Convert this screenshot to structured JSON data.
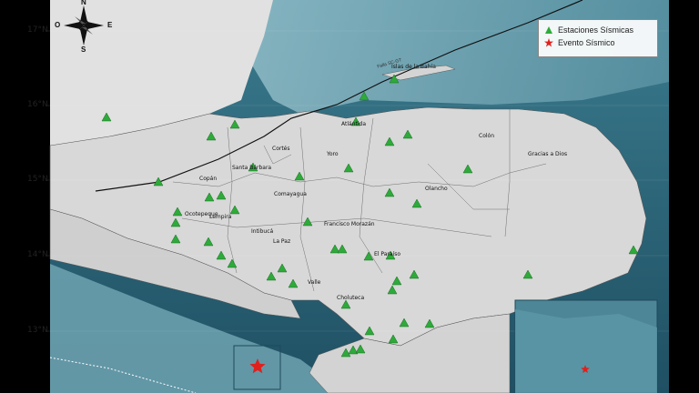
{
  "map": {
    "latitude_labels": [
      "17°N",
      "16°N",
      "15°N",
      "14°N",
      "13°N"
    ],
    "compass": {
      "north": "N",
      "south": "S",
      "east": "E",
      "west": "O"
    },
    "fault_label": "Falla SC-GT",
    "places": [
      {
        "name": "Islas de la Bahía"
      },
      {
        "name": "Atlántida"
      },
      {
        "name": "Colón"
      },
      {
        "name": "Cortés"
      },
      {
        "name": "Yoro"
      },
      {
        "name": "Santa Bárbara"
      },
      {
        "name": "Copán"
      },
      {
        "name": "Gracias a Dios"
      },
      {
        "name": "Comayagua"
      },
      {
        "name": "Olancho"
      },
      {
        "name": "Ocotepeque"
      },
      {
        "name": "Lempira"
      },
      {
        "name": "Intibucá"
      },
      {
        "name": "Francisco Morazán"
      },
      {
        "name": "La Paz"
      },
      {
        "name": "El Paraíso"
      },
      {
        "name": "Valle"
      },
      {
        "name": "Choluteca"
      }
    ]
  },
  "legend": {
    "stations_label": "Estaciones Sísmicas",
    "event_label": "Evento Sísmico",
    "station_color": "#2eaa3a",
    "event_color": "#e0201c"
  },
  "stations_count_note": "",
  "colors": {
    "sea_deep": "#2a5f72",
    "sea_shallow": "#86b7c4",
    "land": "#dcdcdc"
  }
}
